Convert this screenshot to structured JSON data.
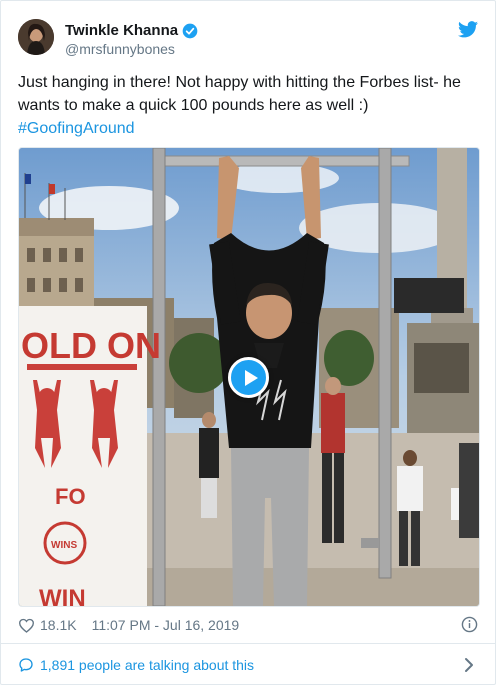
{
  "tweet": {
    "author_name": "Twinkle Khanna",
    "author_handle": "@mrsfunnybones",
    "text_line1": "Just hanging in there! Not happy with hitting the Forbes list- he",
    "text_line2": "wants to make a quick 100 pounds here as well :)",
    "hashtag": "#GoofingAround",
    "likes": "18.1K",
    "timestamp": "11:07 PM - Jul 16, 2019",
    "talking": "1,891 people are talking about this"
  },
  "media": {
    "banner_text_top": "OLD ON",
    "banner_text_mid": "FO",
    "banner_text_bottom": "WIN",
    "banner_small": "WINS"
  },
  "icons": {
    "verified": "verified-badge-icon",
    "brand": "twitter-bird-icon",
    "like": "heart-icon",
    "info": "info-icon",
    "reply": "speech-bubble-icon",
    "play": "play-icon",
    "more": "chevron-right-icon"
  },
  "colors": {
    "accent": "#1da1f2",
    "link": "#1b95e0",
    "muted": "#657786",
    "border": "#e1e8ed"
  }
}
